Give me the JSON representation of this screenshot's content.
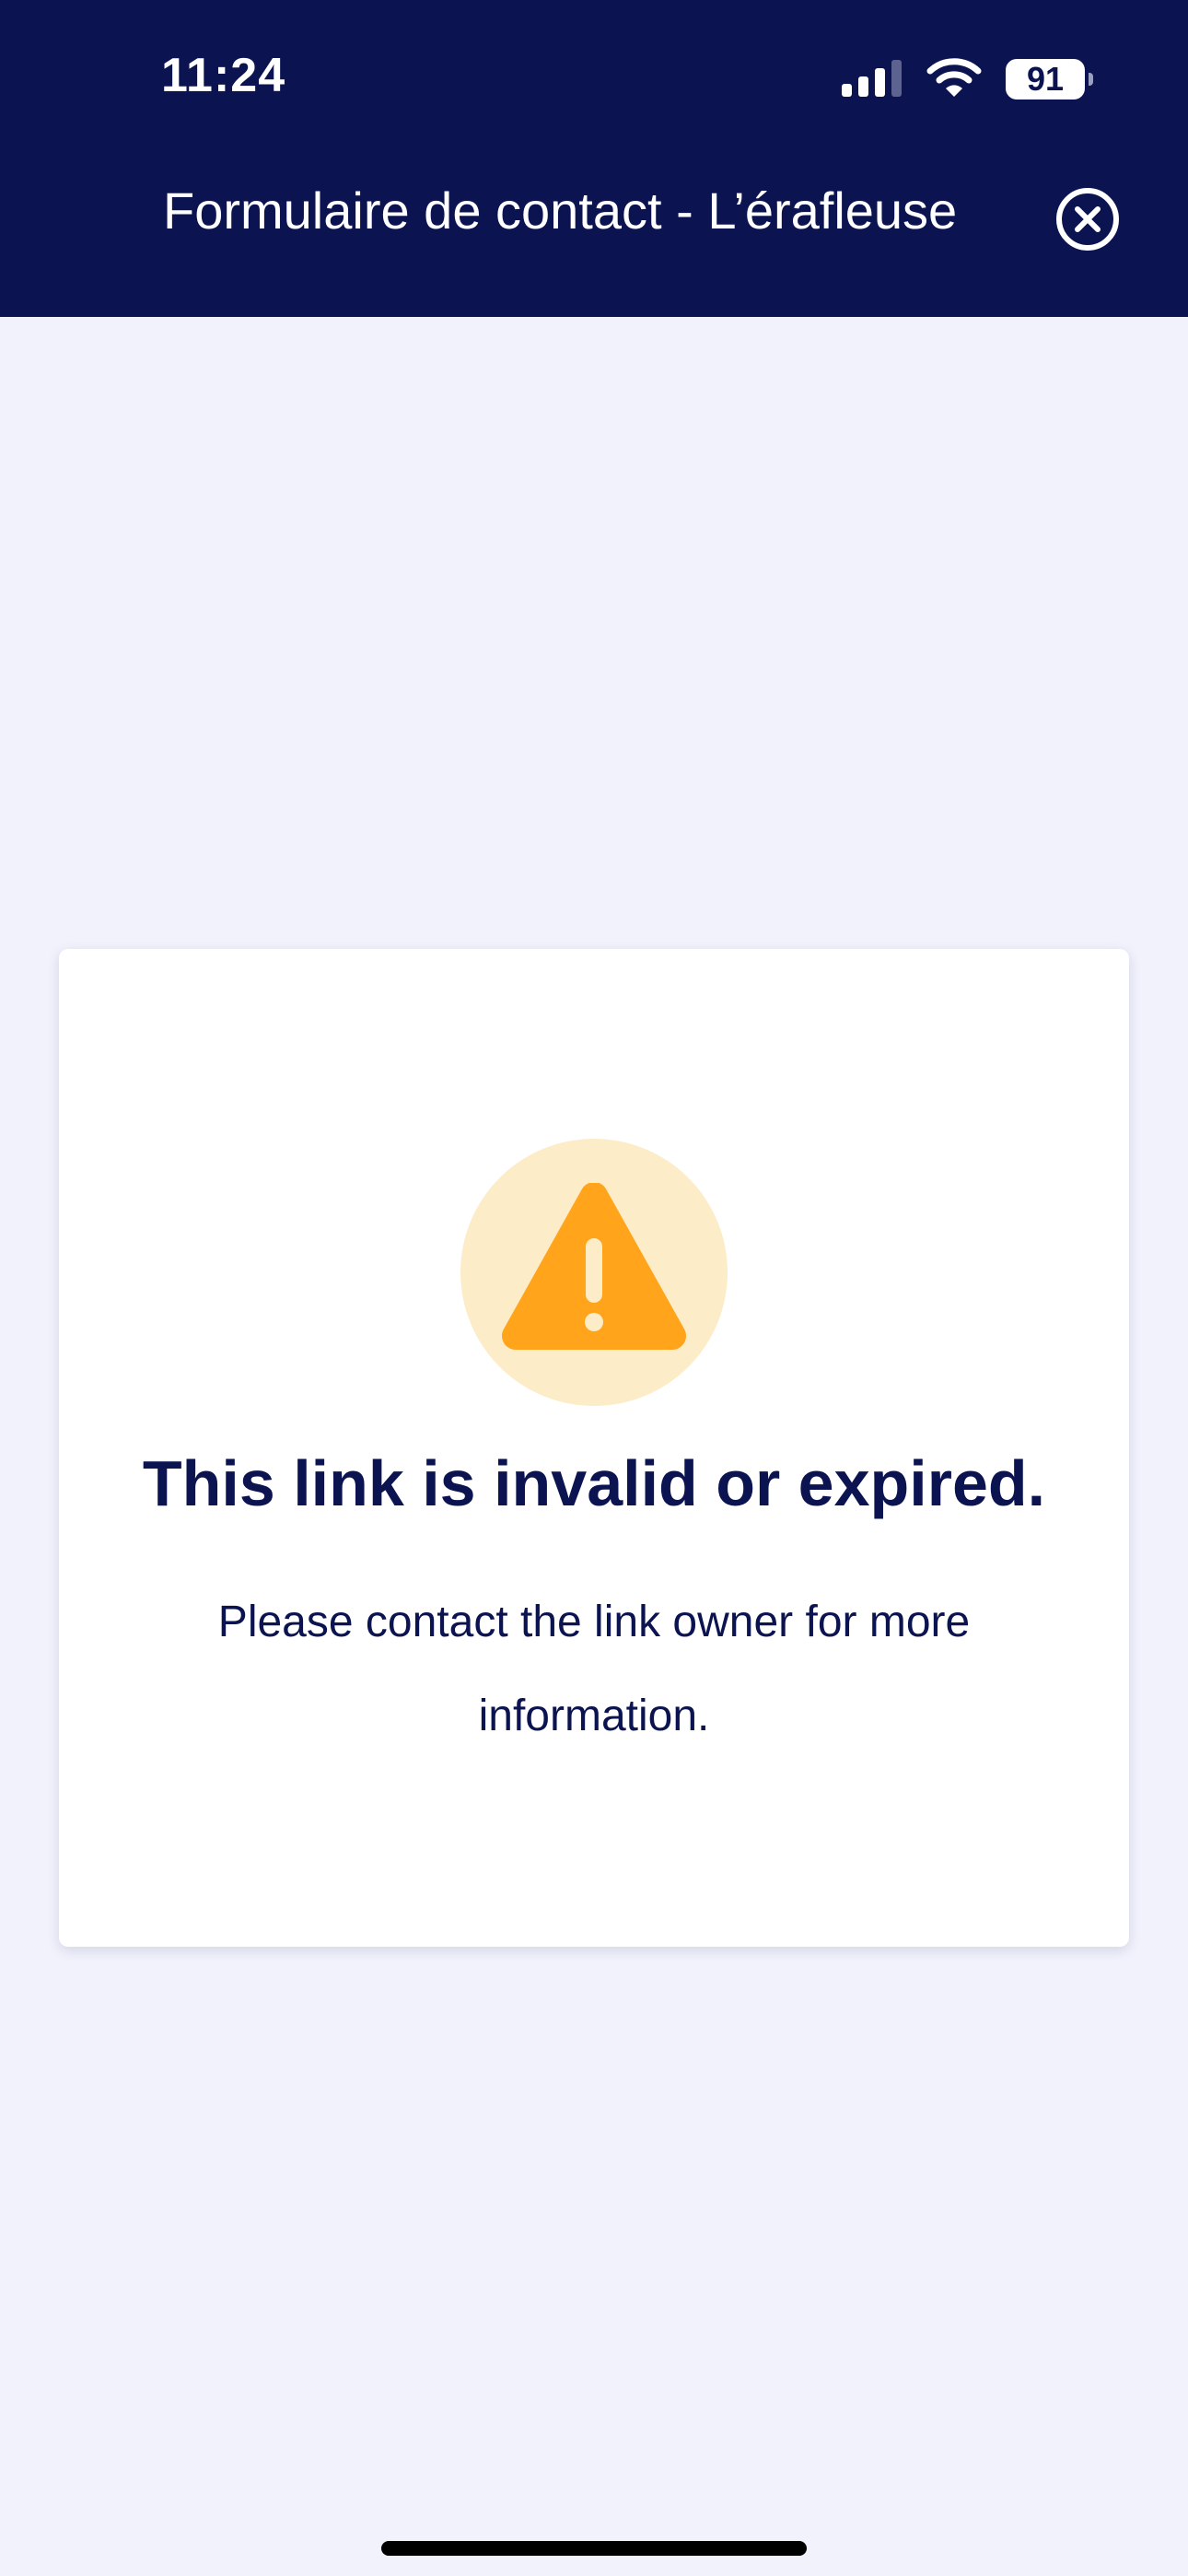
{
  "status_bar": {
    "time": "11:24",
    "battery": "91"
  },
  "header": {
    "title": "Formulaire de contact - L’érafleuse"
  },
  "card": {
    "title": "This link is invalid or expired.",
    "message": "Please contact the link owner for more information."
  },
  "colors": {
    "header_bg": "#0b1450",
    "page_bg": "#f1f2fc",
    "warning": "#ffa41b",
    "warning_bg": "#fdecc8"
  },
  "icons": {
    "signal": "cellular-signal-icon",
    "wifi": "wifi-icon",
    "battery": "battery-icon",
    "close": "close-circle-icon",
    "warning": "warning-triangle-icon"
  }
}
